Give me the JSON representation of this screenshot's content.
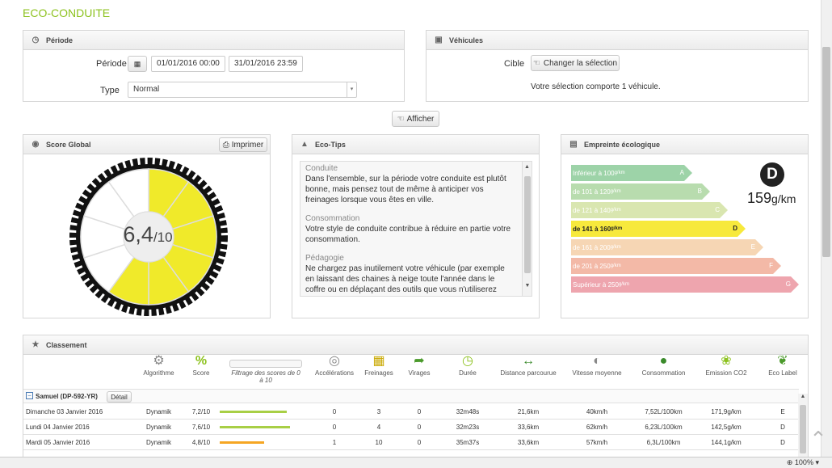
{
  "page_title": "ECO-CONDUITE",
  "periode_panel": {
    "title": "Période",
    "periode_label": "Période",
    "date_start": "01/01/2016 00:00",
    "date_end": "31/01/2016 23:59",
    "type_label": "Type",
    "type_value": "Normal"
  },
  "vehicules_panel": {
    "title": "Véhicules",
    "cible_label": "Cible",
    "change_button": "Changer la sélection",
    "selection_text": "Votre sélection comporte 1 véhicule."
  },
  "afficher_button": "Afficher",
  "score_panel": {
    "title": "Score Global",
    "print_button": "Imprimer",
    "score_main": "6,4",
    "score_denominator": "/10",
    "score_value": 6.4,
    "score_max": 10,
    "fill_color": "#f0ea2a"
  },
  "ecotips_panel": {
    "title": "Eco-Tips",
    "sections": [
      {
        "title": "Conduite",
        "text": "Dans l'ensemble, sur la période votre conduite est plutôt bonne, mais pensez tout de même à anticiper vos freinages lorsque vous êtes en ville."
      },
      {
        "title": "Consommation",
        "text": "Votre style de conduite contribue à réduire en partie votre consommation."
      },
      {
        "title": "Pédagogie",
        "text": "Ne chargez pas inutilement votre véhicule (par exemple en laissant des chaines à neige toute l'année dans le coffre ou en déplaçant des outils que vous n'utiliserez pas)."
      }
    ]
  },
  "empreinte_panel": {
    "title": "Empreinte écologique",
    "grade": "D",
    "value": "159",
    "unit": "g/km",
    "rows": [
      {
        "prefix": "Inférieur à 100",
        "unit": "g/km",
        "grade": "A",
        "color": "#9dd3a8"
      },
      {
        "prefix": "de 101 à 120",
        "unit": "g/km",
        "grade": "B",
        "color": "#b8dcae"
      },
      {
        "prefix": "de 121 à 140",
        "unit": "g/km",
        "grade": "C",
        "color": "#d9e6b0"
      },
      {
        "prefix": "de 141 à 160",
        "unit": "g/km",
        "grade": "D",
        "color": "#f7e93c"
      },
      {
        "prefix": "de 161 à 200",
        "unit": "g/km",
        "grade": "E",
        "color": "#f6d6b4"
      },
      {
        "prefix": "de 201 à 250",
        "unit": "g/km",
        "grade": "F",
        "color": "#f3b9a7"
      },
      {
        "prefix": "Supérieur à 250",
        "unit": "g/km",
        "grade": "G",
        "color": "#eea5ae"
      }
    ],
    "active_index": 3
  },
  "classement_panel": {
    "title": "Classement",
    "columns": {
      "algo": "Algorithme",
      "score": "Score",
      "filtrage": "Filtrage des scores de 0 à 10",
      "accel": "Accélérations",
      "freinages": "Freinages",
      "virages": "Virages",
      "duree": "Durée",
      "distance": "Distance parcourue",
      "vitesse": "Vitesse moyenne",
      "conso": "Consommation",
      "co2": "Emission CO2",
      "label": "Eco Label"
    },
    "group_label": "Samuel (DP-592-YR)",
    "detail_button": "Détail",
    "rows": [
      {
        "date": "Dimanche 03 Janvier 2016",
        "algo": "Dynamik",
        "score": "7,2/10",
        "score_value": 7.2,
        "bar_color": "#a8cf45",
        "accel": "0",
        "frein": "3",
        "virages": "0",
        "duree": "32m48s",
        "distance": "21,6km",
        "vitesse": "40km/h",
        "conso": "7,52L/100km",
        "co2": "171,9g/km",
        "label": "E"
      },
      {
        "date": "Lundi 04 Janvier 2016",
        "algo": "Dynamik",
        "score": "7,6/10",
        "score_value": 7.6,
        "bar_color": "#a8cf45",
        "accel": "0",
        "frein": "4",
        "virages": "0",
        "duree": "32m23s",
        "distance": "33,6km",
        "vitesse": "62km/h",
        "conso": "6,23L/100km",
        "co2": "142,5g/km",
        "label": "D"
      },
      {
        "date": "Mardi 05 Janvier 2016",
        "algo": "Dynamik",
        "score": "4,8/10",
        "score_value": 4.8,
        "bar_color": "#f5a623",
        "accel": "1",
        "frein": "10",
        "virages": "0",
        "duree": "35m37s",
        "distance": "33,6km",
        "vitesse": "57km/h",
        "conso": "6,3L/100km",
        "co2": "144,1g/km",
        "label": "D"
      }
    ]
  },
  "zoom_level": "100%"
}
